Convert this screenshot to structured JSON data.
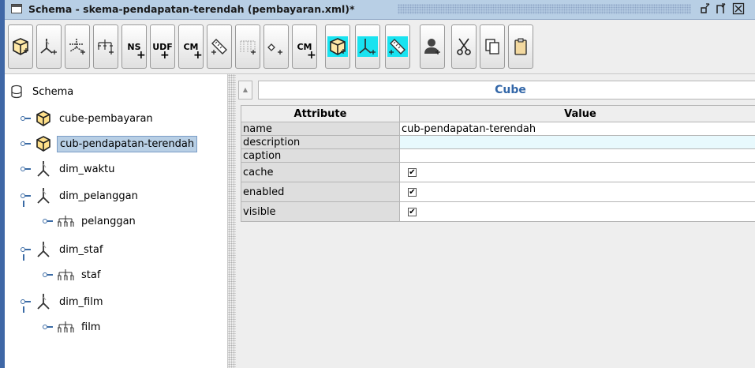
{
  "window": {
    "title": "Schema - skema-pendapatan-terendah (pembayaran.xml)*",
    "minimize_glyph": "ਫ",
    "maximize_glyph": "ਫ",
    "close_glyph": "☒"
  },
  "toolbar": {
    "buttons": [
      {
        "name": "add-cube",
        "icon": "cube-plus-icon"
      },
      {
        "name": "add-dimension",
        "icon": "dimension-plus-icon"
      },
      {
        "name": "add-dimension-usage",
        "icon": "dimension-usage-plus-icon"
      },
      {
        "name": "add-hierarchy",
        "icon": "hierarchy-plus-icon"
      },
      {
        "name": "add-named-set",
        "label": "NS"
      },
      {
        "name": "add-udf",
        "label": "UDF"
      },
      {
        "name": "add-calculated-member",
        "label": "CM"
      },
      {
        "name": "add-measure",
        "icon": "measure-plus-icon"
      },
      {
        "name": "add-level",
        "icon": "level-plus-icon"
      },
      {
        "name": "add-property",
        "icon": "property-plus-icon"
      },
      {
        "name": "add-cube-calculated-member",
        "label": "CM"
      },
      {
        "name": "add-virtual-cube",
        "icon": "virtual-cube-icon"
      },
      {
        "name": "add-virtual-dimension",
        "icon": "virtual-dimension-icon"
      },
      {
        "name": "add-virtual-measure",
        "icon": "virtual-measure-icon"
      },
      {
        "name": "add-role",
        "icon": "role-plus-icon"
      },
      {
        "name": "cut",
        "icon": "scissors-icon"
      },
      {
        "name": "copy",
        "icon": "copy-icon"
      },
      {
        "name": "paste",
        "icon": "paste-icon"
      }
    ]
  },
  "tree": {
    "root": "Schema",
    "items": [
      {
        "label": "cube-pembayaran",
        "type": "cube"
      },
      {
        "label": "cub-pendapatan-terendah",
        "type": "cube",
        "selected": true
      },
      {
        "label": "dim_waktu",
        "type": "dimension"
      },
      {
        "label": "dim_pelanggan",
        "type": "dimension"
      },
      {
        "label": "pelanggan",
        "type": "hierarchy"
      },
      {
        "label": "dim_staf",
        "type": "dimension"
      },
      {
        "label": "staf",
        "type": "hierarchy"
      },
      {
        "label": "dim_film",
        "type": "dimension"
      },
      {
        "label": "film",
        "type": "hierarchy"
      }
    ]
  },
  "panel": {
    "title": "Cube",
    "col_attribute": "Attribute",
    "col_value": "Value",
    "rows": [
      {
        "attr": "name",
        "value": "cub-pendapatan-terendah"
      },
      {
        "attr": "description",
        "value": ""
      },
      {
        "attr": "caption",
        "value": ""
      },
      {
        "attr": "cache",
        "checked": true
      },
      {
        "attr": "enabled",
        "checked": true
      },
      {
        "attr": "visible",
        "checked": true
      }
    ],
    "check_glyph": "✔"
  },
  "colors": {
    "highlight": "#19e3f0",
    "accent": "#3367a8",
    "selection": "#b8cfe5"
  }
}
